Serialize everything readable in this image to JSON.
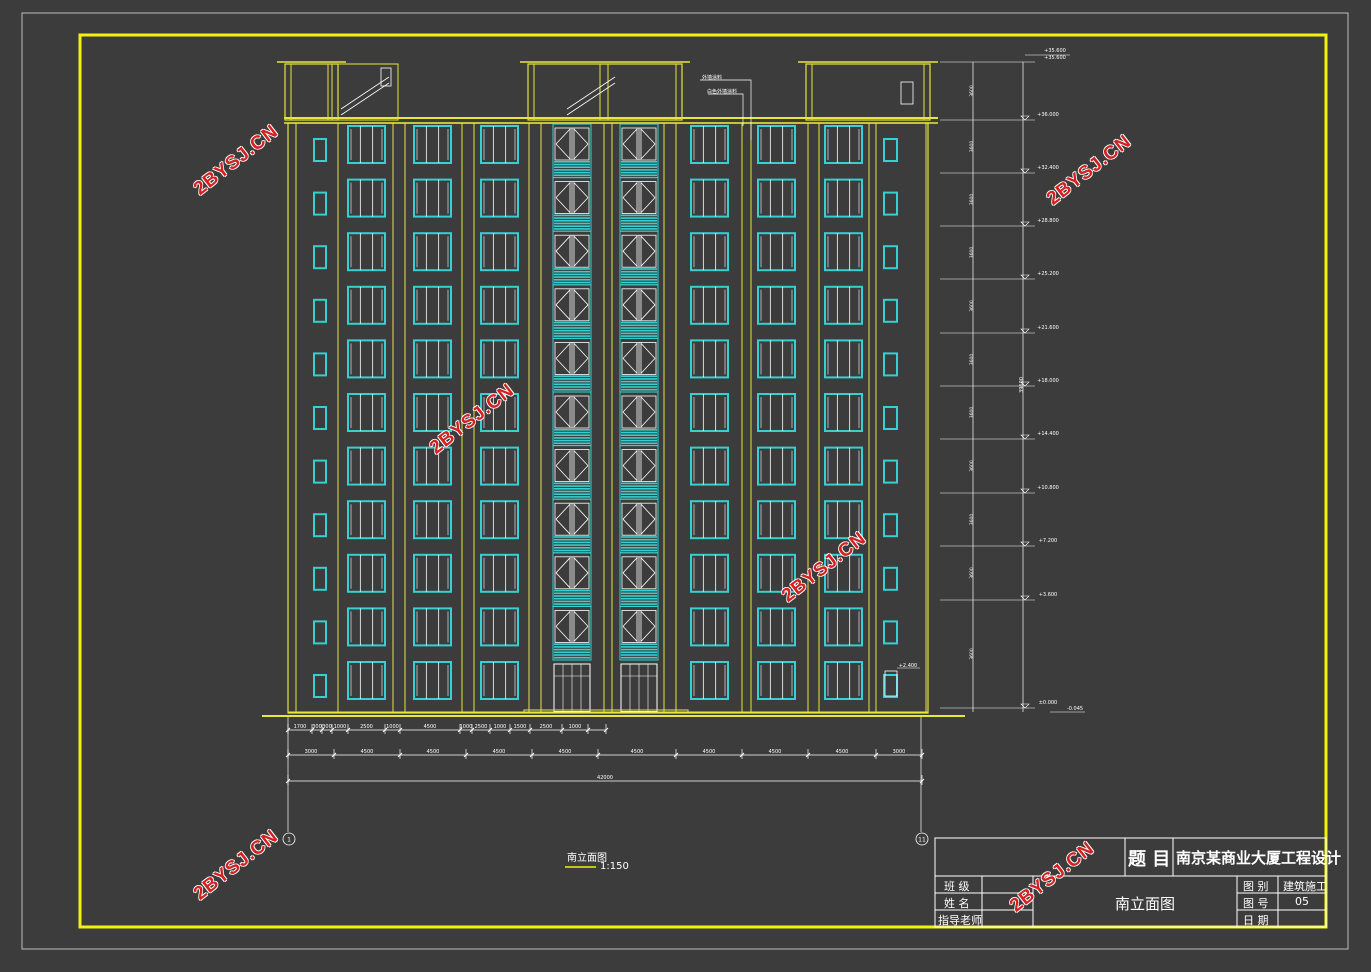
{
  "drawing": {
    "caption": "南立面图",
    "scale": "1:150",
    "axis_labels": [
      "1",
      "11"
    ],
    "elevations_top": [
      "+35.600",
      "+35.600"
    ],
    "elevations": [
      "+36.000",
      "+32.400",
      "+28.800",
      "+25.200",
      "+21.600",
      "+18.000",
      "+14.400",
      "+10.800",
      "+7.200",
      "+3.600",
      "±0.000"
    ],
    "ground_level": "-0.045",
    "small_level": "+2.400",
    "dims_row1": [
      "1700",
      "300",
      "300",
      "1000",
      "2500",
      "1000",
      "4500",
      "1000",
      "2500",
      "1000",
      "1500",
      "2500",
      "1000"
    ],
    "dims_row2": [
      "3000",
      "4500",
      "4500",
      "4500",
      "4500",
      "4500",
      "4500",
      "4500",
      "4500",
      "3000"
    ],
    "total_dim": "42000",
    "leader_notes": [
      "外墙涂料",
      "白色外墙涂料"
    ]
  },
  "title_block": {
    "title_label": "题 目",
    "project": "南京某商业大厦工程设计",
    "class_label": "班 级",
    "name_label": "姓 名",
    "advisor_label": "指导老师",
    "drawing_name": "南立面图",
    "category_label": "图 别",
    "category_value": "建筑施工",
    "number_label": "图 号",
    "number_value": "05",
    "date_label": "日 期"
  },
  "watermark": "2BYSJ.CN",
  "colors": {
    "background": "#3c3c3c",
    "frame": "#f2f20a",
    "building": "#e6e63c",
    "glass": "#36d0d0",
    "lines": "#ffffff",
    "watermark": "#d42020"
  }
}
